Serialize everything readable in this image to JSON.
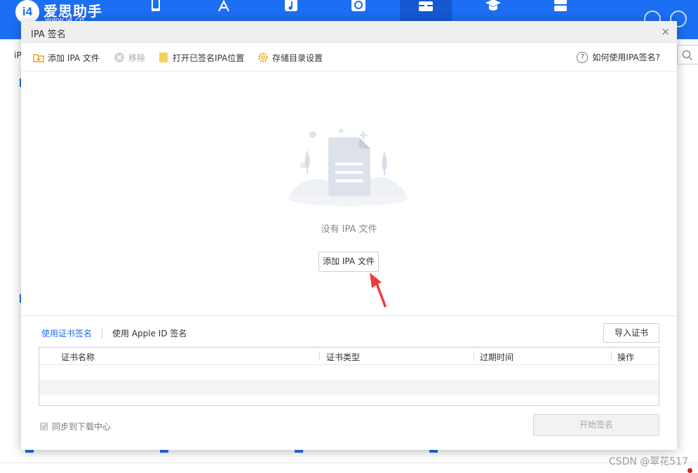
{
  "app": {
    "logo_mark": "i4",
    "logo_text": "爱思助手",
    "logo_url": "www.i4.cn",
    "brand_color": "#1c6ef2",
    "nav_icons": [
      "phone-icon",
      "app-store-icon",
      "music-icon",
      "sync-icon",
      "toolbox-icon",
      "graduation-cap-icon",
      "robot-icon"
    ],
    "active_nav": "toolbox-icon",
    "background_left_text": "iP"
  },
  "modal": {
    "title": "IPA 签名",
    "close_glyph": "×",
    "toolbar": {
      "add_ipa": "添加 IPA 文件",
      "remove": "移除",
      "open_location": "打开已签名IPA位置",
      "storage_settings": "存储目录设置",
      "help": "如何使用IPA签名?",
      "help_glyph": "?"
    },
    "empty_state": {
      "message": "没有 IPA 文件",
      "add_button": "添加 IPA 文件"
    },
    "sign_tabs": {
      "cert": "使用证书签名",
      "apple_id": "使用 Apple ID 签名",
      "active": "cert"
    },
    "import_cert": "导入证书",
    "table": {
      "columns": [
        "证书名称",
        "证书类型",
        "过期时间",
        "操作"
      ],
      "rows": []
    },
    "sync_label": "同步到下载中心",
    "sync_checked": true,
    "start_button": "开始签名"
  },
  "watermark": "CSDN @翠花517"
}
